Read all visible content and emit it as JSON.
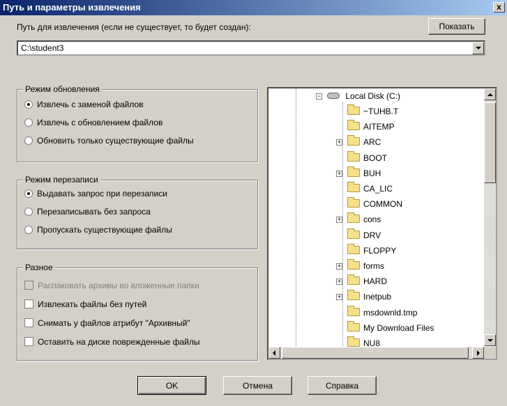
{
  "window": {
    "title": "Путь и параметры извлечения",
    "close": "x"
  },
  "path": {
    "label": "Путь для извлечения (если не существует, то будет создан):",
    "value": "C:\\student3",
    "show_button": "Показать"
  },
  "update_mode": {
    "title": "Режим обновления",
    "options": [
      {
        "label": "Извлечь с заменой файлов",
        "selected": true
      },
      {
        "label": "Извлечь с обновлением файлов",
        "selected": false
      },
      {
        "label": "Обновить только существующие файлы",
        "selected": false
      }
    ]
  },
  "overwrite_mode": {
    "title": "Режим перезаписи",
    "options": [
      {
        "label": "Выдавать запрос при перезаписи",
        "selected": true
      },
      {
        "label": "Перезаписывать без запроса",
        "selected": false
      },
      {
        "label": "Пропускать существующие файлы",
        "selected": false
      }
    ]
  },
  "misc": {
    "title": "Разное",
    "options": [
      {
        "label": "Распаковать архивы во вложенные папки",
        "checked": false,
        "disabled": true
      },
      {
        "label": "Извлекать файлы без путей",
        "checked": false,
        "disabled": false
      },
      {
        "label": "Снимать у файлов атрибут \"Архивный\"",
        "checked": false,
        "disabled": false
      },
      {
        "label": "Оставить на диске поврежденные файлы",
        "checked": false,
        "disabled": false
      }
    ]
  },
  "tree": {
    "root": "Local Disk (C:)",
    "items": [
      {
        "label": "~TUHB.T",
        "expandable": false
      },
      {
        "label": "AITEMP",
        "expandable": false
      },
      {
        "label": "ARC",
        "expandable": true
      },
      {
        "label": "BOOT",
        "expandable": false
      },
      {
        "label": "BUH",
        "expandable": true
      },
      {
        "label": "CA_LIC",
        "expandable": false
      },
      {
        "label": "COMMON",
        "expandable": false
      },
      {
        "label": "cons",
        "expandable": true
      },
      {
        "label": "DRV",
        "expandable": false
      },
      {
        "label": "FLOPPY",
        "expandable": false
      },
      {
        "label": "forms",
        "expandable": true
      },
      {
        "label": "HARD",
        "expandable": true
      },
      {
        "label": "Inetpub",
        "expandable": true
      },
      {
        "label": "msdownld.tmp",
        "expandable": false
      },
      {
        "label": "My Download Files",
        "expandable": false
      },
      {
        "label": "NU8",
        "expandable": false
      }
    ]
  },
  "buttons": {
    "ok": "OK",
    "cancel": "Отмена",
    "help": "Справка"
  }
}
